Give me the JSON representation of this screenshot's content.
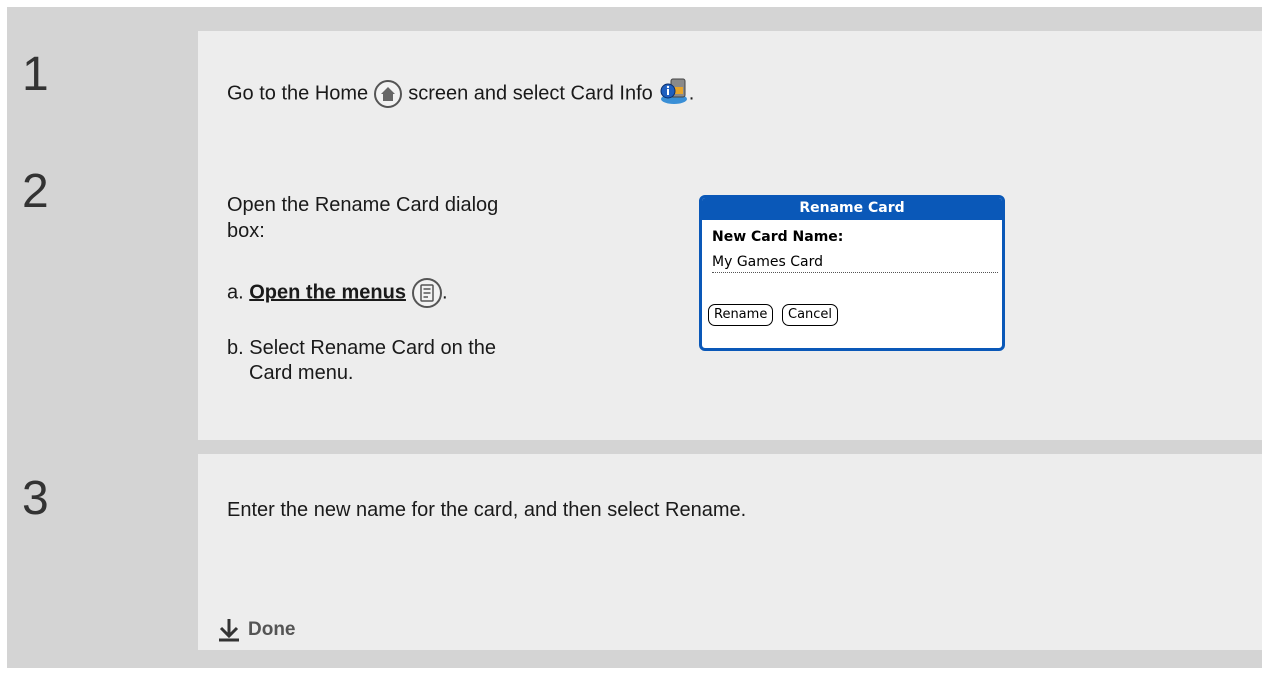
{
  "steps": [
    {
      "number": "1",
      "text_before": "Go to the Home",
      "text_middle": "screen and select Card Info",
      "text_after": ".",
      "icons": [
        "home-icon",
        "card-info-icon"
      ]
    },
    {
      "number": "2",
      "intro_line1": "Open the Rename Card dialog",
      "intro_line2": "box:",
      "sub_a_marker": "a.",
      "sub_a_link": "Open the menus",
      "sub_a_after": ".",
      "sub_b_marker": "b.",
      "sub_b_line1": "Select Rename Card on the",
      "sub_b_line2": "Card menu.",
      "dialog": {
        "title": "Rename Card",
        "field_label": "New Card Name:",
        "field_value": "My Games Card",
        "rename_button": "Rename",
        "cancel_button": "Cancel"
      }
    },
    {
      "number": "3",
      "text": "Enter the new name for the card, and then select Rename.",
      "done_label": "Done"
    }
  ],
  "colors": {
    "frame": "#d4d4d4",
    "content": "#ededed",
    "dialog_blue": "#0a58b8"
  }
}
